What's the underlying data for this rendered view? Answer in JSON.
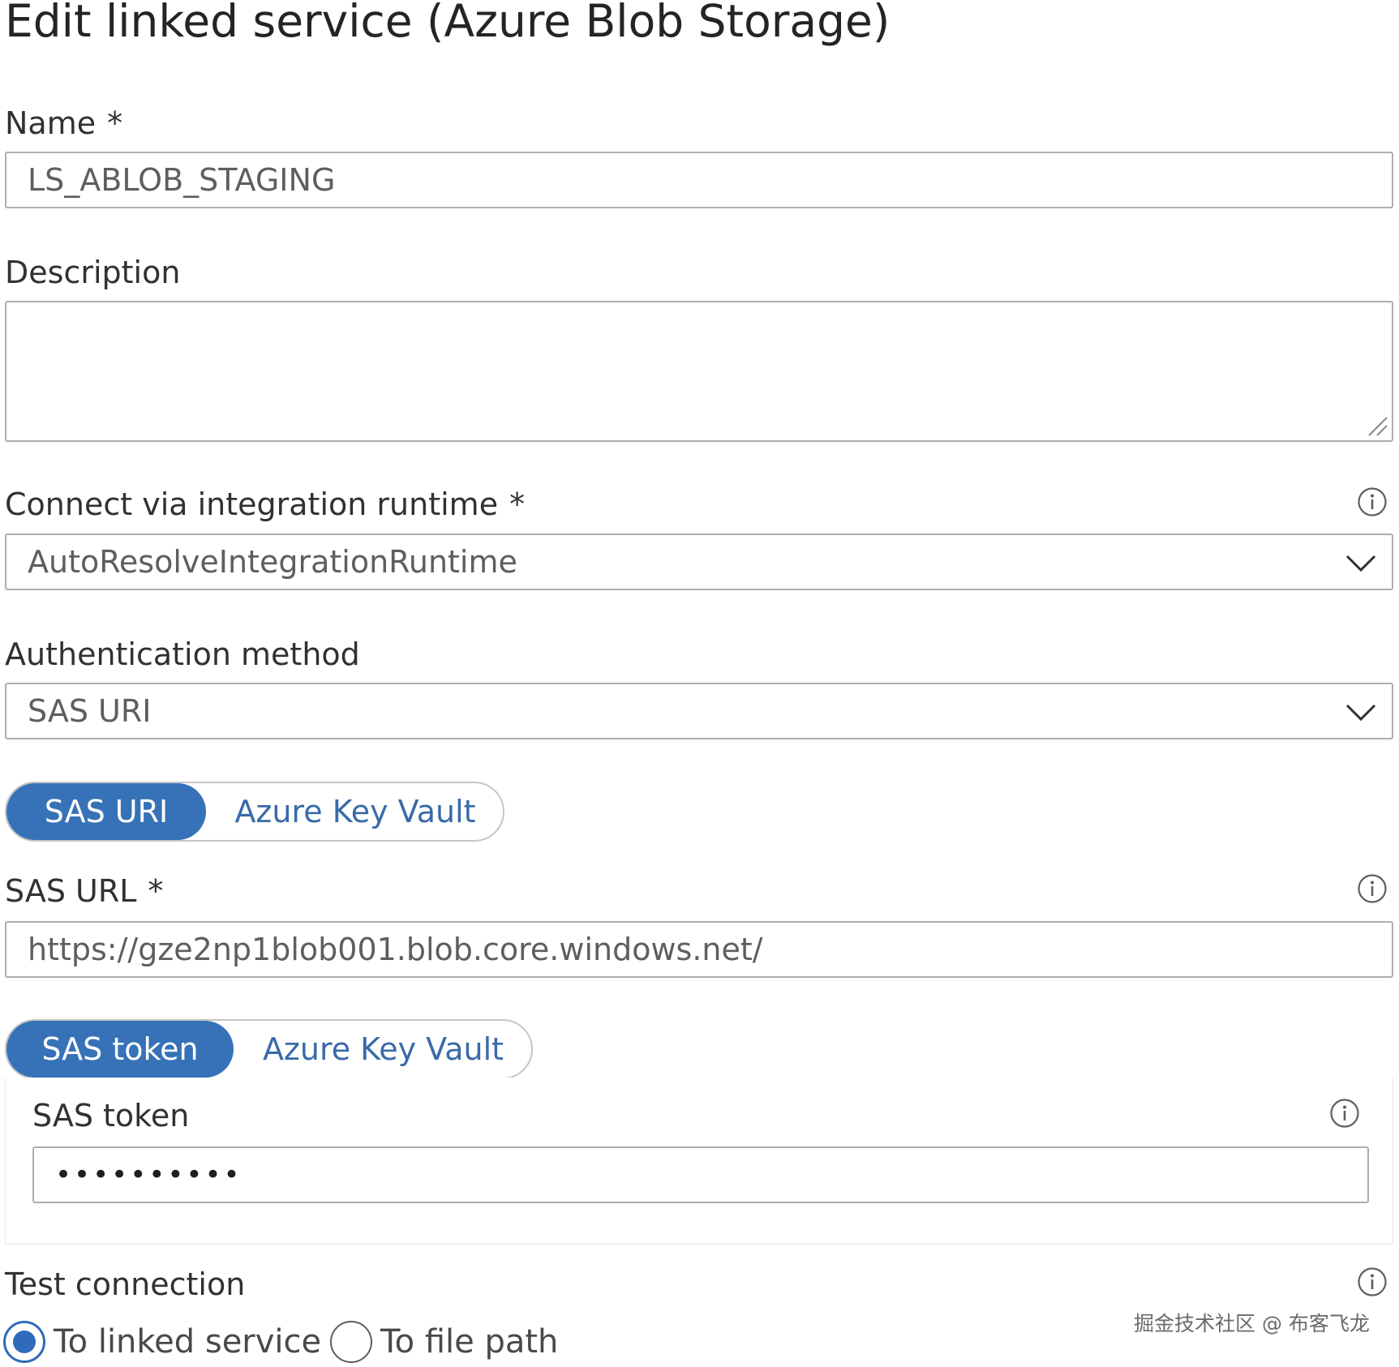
{
  "title": "Edit linked service (Azure Blob Storage)",
  "name": {
    "label": "Name",
    "required_mark": "*",
    "value": "LS_ABLOB_STAGING"
  },
  "description": {
    "label": "Description",
    "value": ""
  },
  "integration_runtime": {
    "label": "Connect via integration runtime",
    "required_mark": "*",
    "selected": "AutoResolveIntegrationRuntime"
  },
  "authentication": {
    "label": "Authentication method",
    "selected": "SAS URI"
  },
  "uri_source_toggle": {
    "options": [
      "SAS URI",
      "Azure Key Vault"
    ],
    "active": "SAS URI"
  },
  "sas_url": {
    "label": "SAS URL",
    "required_mark": "*",
    "value": "https://gze2np1blob001.blob.core.windows.net/"
  },
  "token_source_toggle": {
    "options": [
      "SAS token",
      "Azure Key Vault"
    ],
    "active": "SAS token"
  },
  "sas_token": {
    "label": "SAS token",
    "masked_value": "••••••••••"
  },
  "test_connection": {
    "label": "Test connection",
    "options": [
      "To linked service",
      "To file path"
    ],
    "selected": "To linked service"
  },
  "watermark": "掘金技术社区 @ 布客飞龙",
  "colors": {
    "accent": "#3772b8",
    "inactive_link": "#3a6aa8",
    "border": "#b0aeab"
  }
}
